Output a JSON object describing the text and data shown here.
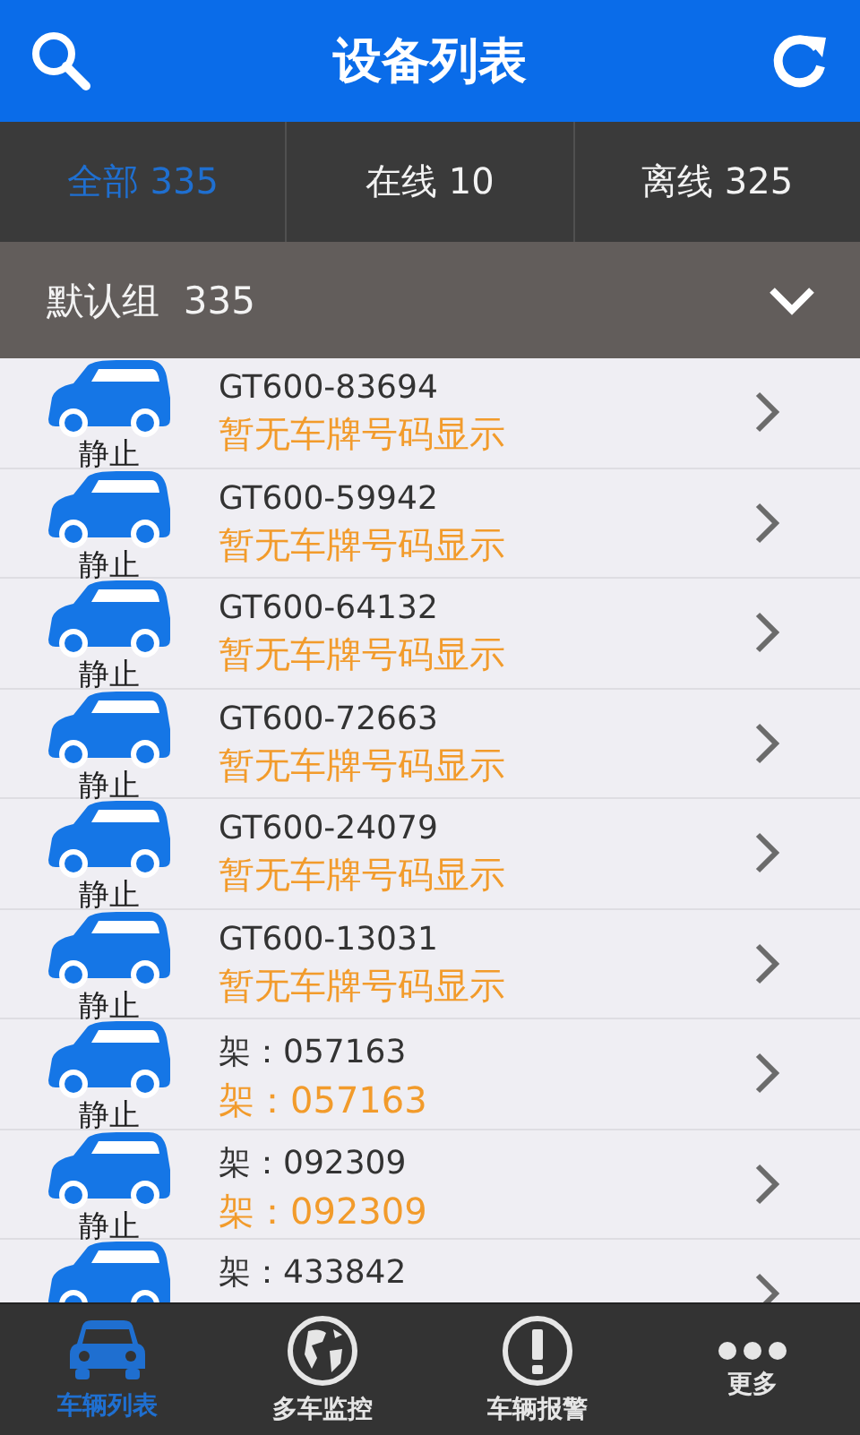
{
  "header": {
    "title": "设备列表"
  },
  "tabs": [
    {
      "label": "全部 335",
      "selected": true
    },
    {
      "label": "在线 10",
      "selected": false
    },
    {
      "label": "离线 325",
      "selected": false
    }
  ],
  "group": {
    "name": "默认组",
    "count": "335",
    "expanded": false
  },
  "devices": [
    {
      "status": "静止",
      "name": "GT600-83694",
      "plate": "暂无车牌号码显示"
    },
    {
      "status": "静止",
      "name": "GT600-59942",
      "plate": "暂无车牌号码显示"
    },
    {
      "status": "静止",
      "name": "GT600-64132",
      "plate": "暂无车牌号码显示"
    },
    {
      "status": "静止",
      "name": "GT600-72663",
      "plate": "暂无车牌号码显示"
    },
    {
      "status": "静止",
      "name": "GT600-24079",
      "plate": "暂无车牌号码显示"
    },
    {
      "status": "静止",
      "name": "GT600-13031",
      "plate": "暂无车牌号码显示"
    },
    {
      "status": "静止",
      "name": "架：057163",
      "plate": "架：057163"
    },
    {
      "status": "静止",
      "name": "架：092309",
      "plate": "架：092309"
    },
    {
      "name": "架：433842"
    }
  ],
  "nav": [
    {
      "kind": "car",
      "label": "车辆列表",
      "selected": true
    },
    {
      "kind": "globe",
      "label": "多车监控",
      "selected": false
    },
    {
      "kind": "alert",
      "label": "车辆报警",
      "selected": false
    },
    {
      "kind": "more",
      "label": "更多",
      "selected": false
    }
  ]
}
